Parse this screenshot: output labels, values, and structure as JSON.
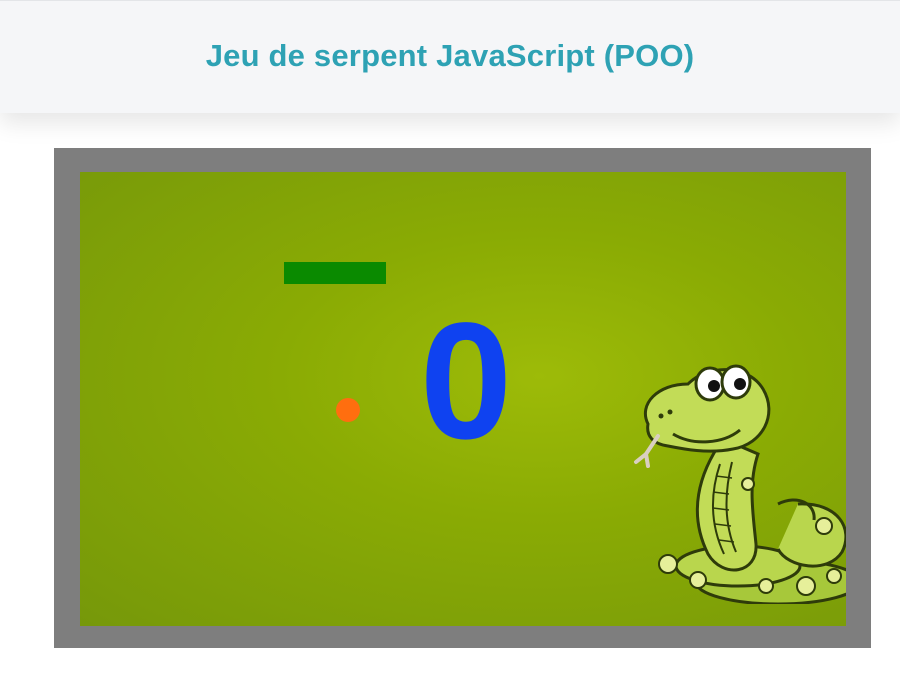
{
  "header": {
    "title": "Jeu de serpent JavaScript (POO)"
  },
  "game": {
    "score": "0",
    "icons": [
      "snake-mascot-icon"
    ],
    "colors": {
      "title": "#2ea2b4",
      "frame": "#7e7e7e",
      "board": "#8aab04",
      "snake": "#0a8a00",
      "food": "#ff6e0f",
      "score": "#0f42f0"
    }
  }
}
